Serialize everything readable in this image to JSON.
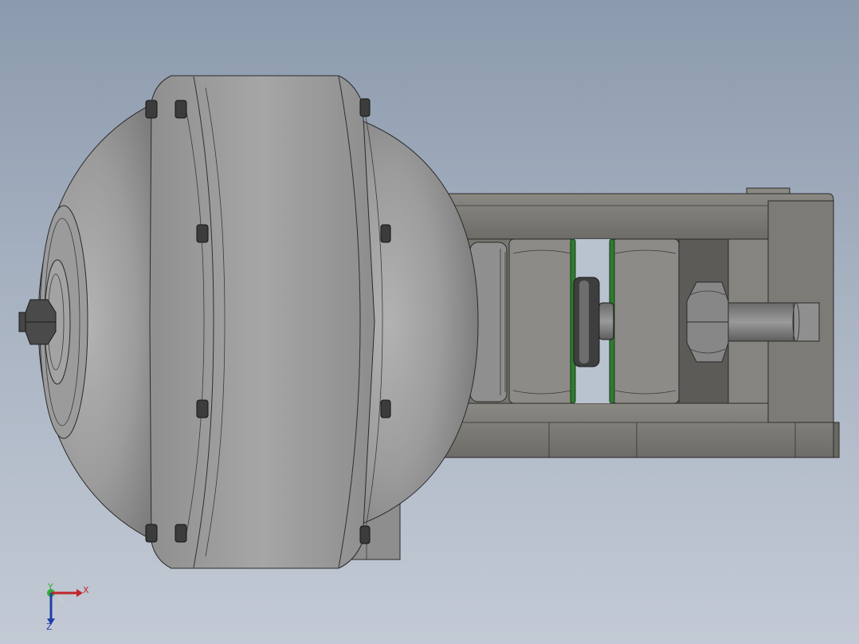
{
  "viewport": {
    "background_top": "#8b9aad",
    "background_bottom": "#c3cad5"
  },
  "model": {
    "housing_color": "#9e9e9e",
    "frame_color": "#7c7a74",
    "spacer_color": "#2f7a2f",
    "fastener_color": "#3a3a3a"
  },
  "triad": {
    "x_label": "X",
    "y_label": "Y",
    "z_label": "Z",
    "x_color": "#c0262b",
    "y_color": "#2fae3a",
    "z_color": "#1f3fa8"
  }
}
